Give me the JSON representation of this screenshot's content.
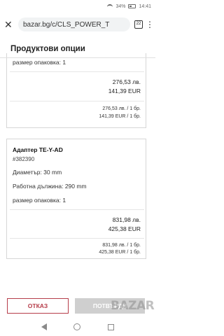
{
  "status_bar": {
    "left": "",
    "battery": "34%",
    "time": "14:41"
  },
  "browser": {
    "url": "bazar.bg/c/CLS_POWER_T",
    "tab_count": "22",
    "menu_glyph": "⋮",
    "close_glyph": "✕"
  },
  "page": {
    "title": "Продуктови опции"
  },
  "products": [
    {
      "pack_label": "размер опаковка: 1",
      "price_bgn": "276,53 лв.",
      "price_eur": "141,39 EUR",
      "unit_bgn": "276,53 лв. / 1 бр.",
      "unit_eur": "141,39 EUR / 1 бр."
    },
    {
      "name": "Адаптер TE-Y-AD",
      "code": "#382390",
      "diameter": "Диаметър: 30 mm",
      "working_length": "Работна дължина: 290 mm",
      "pack_label": "размер опаковка: 1",
      "price_bgn": "831,98 лв.",
      "price_eur": "425,38 EUR",
      "unit_bgn": "831,98 лв. / 1 бр.",
      "unit_eur": "425,38 EUR / 1 бр."
    }
  ],
  "actions": {
    "cancel": "ОТКАЗ",
    "confirm": "ПОТВЪРДИ"
  },
  "watermark": "BAZAR",
  "colors": {
    "accent": "#b63d4a",
    "disabled": "#cfcfcf"
  }
}
